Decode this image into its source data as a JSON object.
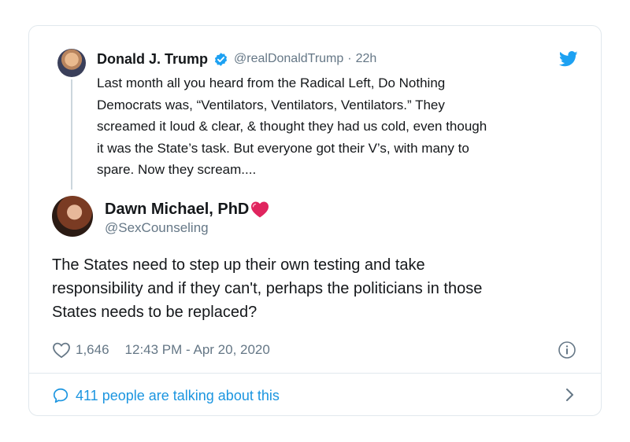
{
  "quoted_tweet": {
    "author_name": "Donald J. Trump",
    "handle": "@realDonaldTrump",
    "separator": "·",
    "time_ago": "22h",
    "body_lines": [
      "Last month all you heard from the Radical Left, Do Nothing",
      "Democrats was, “Ventilators, Ventilators, Ventilators.” They",
      "screamed it loud & clear, & thought they had us cold, even though",
      "it was the State’s task. But everyone got their V’s, with many to",
      "spare. Now they scream...."
    ]
  },
  "reply_tweet": {
    "author_name": "Dawn Michael, PhD",
    "handle": "@SexCounseling",
    "body_lines": [
      "The States need to step up their own testing and take",
      "responsibility and if they can't, perhaps the politicians in those",
      "States needs to be replaced?"
    ]
  },
  "meta": {
    "like_count": "1,646",
    "timestamp": "12:43 PM - Apr 20, 2020"
  },
  "footer": {
    "talking_label": "411 people are talking about this"
  },
  "colors": {
    "accent": "#1b95e0",
    "secondary_text": "#657786",
    "heart": "#e0245e",
    "border": "#e1e8ed"
  },
  "icons": [
    "verified-badge-icon",
    "twitter-bird-icon",
    "heart-emoji-icon",
    "heart-outline-icon",
    "info-icon",
    "speech-bubble-icon",
    "chevron-right-icon"
  ]
}
